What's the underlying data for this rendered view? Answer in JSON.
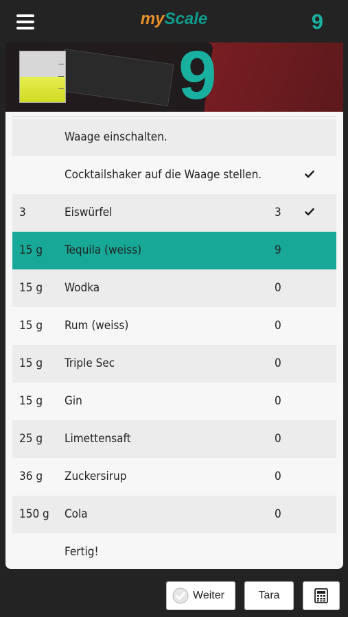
{
  "header": {
    "brand_my": "my",
    "brand_scale": "Scale",
    "weight": "9",
    "menu_icon": "hamburger-menu-icon"
  },
  "display": {
    "weight": "9",
    "glass_fill_fraction": 0.5
  },
  "recipe": {
    "rows": [
      {
        "amount": "",
        "name": "Waage einschalten.",
        "value": "",
        "checked": false
      },
      {
        "amount": "",
        "name": "Cocktailshaker auf die Waage stellen.",
        "value": "",
        "checked": true
      },
      {
        "amount": "3",
        "name": "Eiswürfel",
        "value": "3",
        "checked": true
      },
      {
        "amount": "15 g",
        "name": "Tequila (weiss)",
        "value": "9",
        "checked": false,
        "active": true
      },
      {
        "amount": "15 g",
        "name": "Wodka",
        "value": "0",
        "checked": false
      },
      {
        "amount": "15 g",
        "name": "Rum (weiss)",
        "value": "0",
        "checked": false
      },
      {
        "amount": "15 g",
        "name": "Triple Sec",
        "value": "0",
        "checked": false
      },
      {
        "amount": "15 g",
        "name": "Gin",
        "value": "0",
        "checked": false
      },
      {
        "amount": "25 g",
        "name": "Limettensaft",
        "value": "0",
        "checked": false
      },
      {
        "amount": "36 g",
        "name": "Zuckersirup",
        "value": "0",
        "checked": false
      },
      {
        "amount": "150 g",
        "name": "Cola",
        "value": "0",
        "checked": false
      },
      {
        "amount": "",
        "name": "Fertig!",
        "value": "",
        "checked": false
      }
    ]
  },
  "footer": {
    "weiter_label": "Weiter",
    "tara_label": "Tara",
    "calc_icon": "calculator-icon"
  },
  "colors": {
    "accent": "#17a898",
    "brand_orange": "#e8902a",
    "background": "#232323"
  }
}
